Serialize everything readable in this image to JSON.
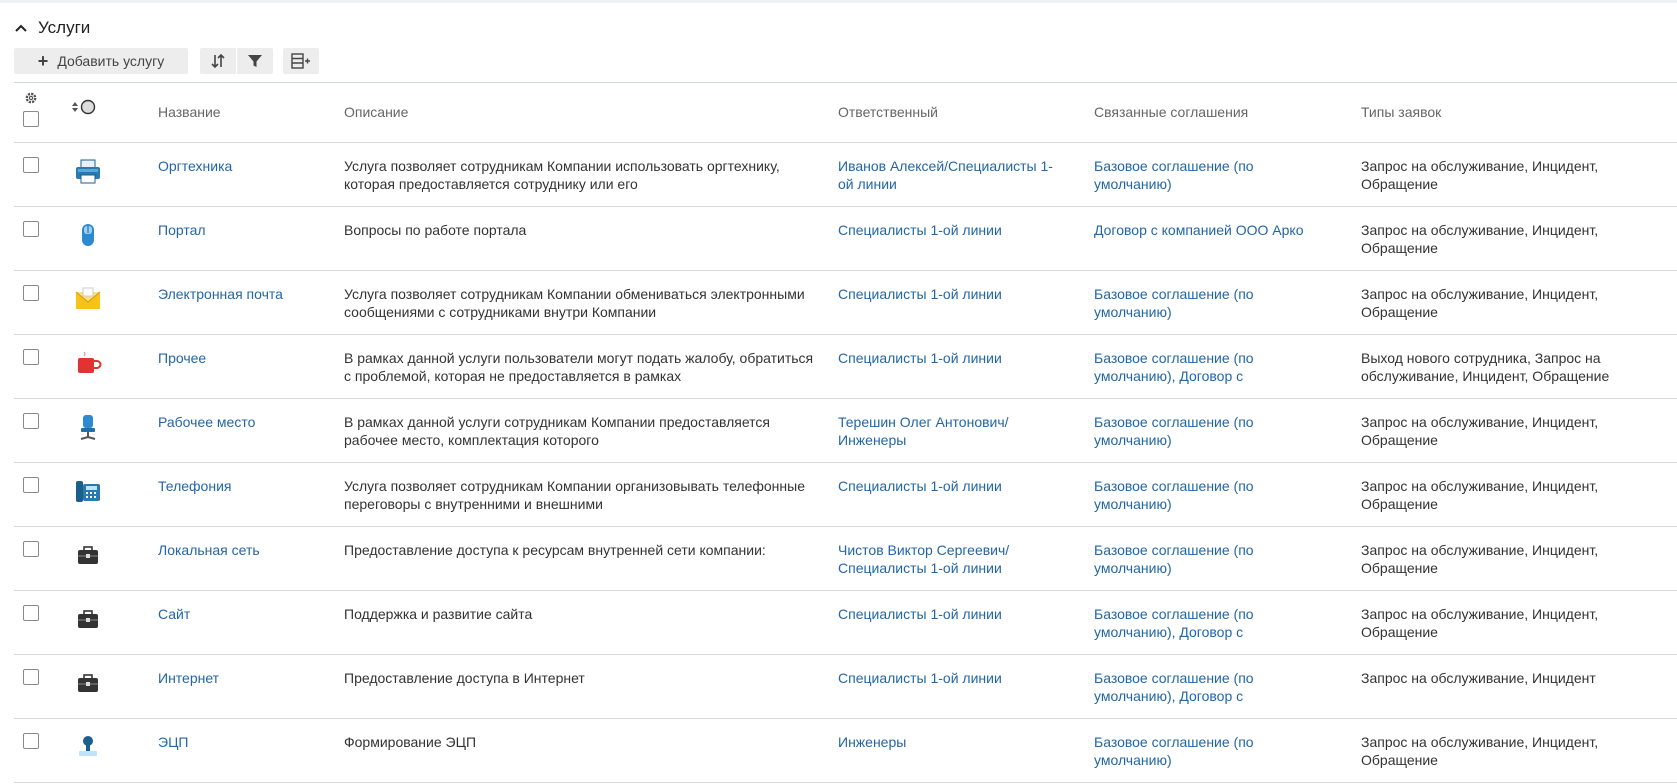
{
  "section": {
    "title": "Услуги"
  },
  "toolbar": {
    "add_label": "Добавить услугу"
  },
  "table": {
    "headers": {
      "name": "Название",
      "description": "Описание",
      "responsible": "Ответственный",
      "agreements": "Связанные соглашения",
      "types": "Типы заявок"
    },
    "rows": [
      {
        "icon": "printer-icon",
        "name": "Оргтехника",
        "description": "Услуга позволяет сотрудникам Компании использовать оргтехнику, которая предоставляется сотруднику или его",
        "responsible_1": "Иванов Алексей",
        "responsible_sep": "/",
        "responsible_2": "Специалисты 1-ой линии",
        "agreements": "Базовое соглашение (по умолчанию)",
        "types": "Запрос на обслуживание, Инцидент, Обращение"
      },
      {
        "icon": "mouse-icon",
        "name": "Портал",
        "description": "Вопросы по работе портала",
        "responsible_1": "Специалисты 1-ой линии",
        "responsible_sep": "",
        "responsible_2": "",
        "agreements": "Договор с компанией ООО Арко",
        "types": "Запрос на обслуживание, Инцидент, Обращение"
      },
      {
        "icon": "envelope-icon",
        "name": "Электронная почта",
        "description": "Услуга позволяет сотрудникам Компании обмениваться электронными сообщениями с сотрудниками внутри Компании",
        "responsible_1": "Специалисты 1-ой линии",
        "responsible_sep": "",
        "responsible_2": "",
        "agreements": "Базовое соглашение (по умолчанию)",
        "types": "Запрос на обслуживание, Инцидент, Обращение"
      },
      {
        "icon": "cup-icon",
        "name": "Прочее",
        "description": "В рамках данной услуги пользователи могут подать жалобу, обратиться с проблемой, которая не предоставляется в рамках",
        "responsible_1": "Специалисты 1-ой линии",
        "responsible_sep": "",
        "responsible_2": "",
        "agreements": "Базовое соглашение (по умолчанию), Договор с",
        "types": "Выход нового сотрудника, Запрос на обслуживание, Инцидент, Обращение"
      },
      {
        "icon": "office-chair-icon",
        "name": "Рабочее место",
        "description": "В рамках данной услуги сотрудникам Компании предоставляется рабочее место, комплектация которого",
        "responsible_1": "Терешин Олег Антонович",
        "responsible_sep": "/",
        "responsible_2": "Инженеры",
        "agreements": "Базовое соглашение (по умолчанию)",
        "types": "Запрос на обслуживание, Инцидент, Обращение"
      },
      {
        "icon": "phone-icon",
        "name": "Телефония",
        "description": "Услуга позволяет сотрудникам Компании организовывать телефонные переговоры с внутренними и внешними",
        "responsible_1": "Специалисты 1-ой линии",
        "responsible_sep": "",
        "responsible_2": "",
        "agreements": "Базовое соглашение (по умолчанию)",
        "types": "Запрос на обслуживание, Инцидент, Обращение"
      },
      {
        "icon": "briefcase-icon",
        "name": "Локальная сеть",
        "description": "Предоставление доступа к ресурсам внутренней сети компании:",
        "responsible_1": "Чистов Виктор Сергеевич",
        "responsible_sep": "/",
        "responsible_2": "Специалисты 1-ой линии",
        "agreements": "Базовое соглашение (по умолчанию)",
        "types": "Запрос на обслуживание, Инцидент, Обращение"
      },
      {
        "icon": "briefcase-icon",
        "name": "Сайт",
        "description": "Поддержка и развитие сайта",
        "responsible_1": "Специалисты 1-ой линии",
        "responsible_sep": "",
        "responsible_2": "",
        "agreements": "Базовое соглашение (по умолчанию), Договор с",
        "types": "Запрос на обслуживание, Инцидент, Обращение"
      },
      {
        "icon": "briefcase-icon",
        "name": "Интернет",
        "description": "Предоставление доступа в Интернет",
        "responsible_1": "Специалисты 1-ой линии",
        "responsible_sep": "",
        "responsible_2": "",
        "agreements": "Базовое соглашение (по умолчанию), Договор с",
        "types": "Запрос на обслуживание, Инцидент"
      },
      {
        "icon": "stamp-icon",
        "name": "ЭЦП",
        "description": "Формирование ЭЦП",
        "responsible_1": "Инженеры",
        "responsible_sep": "",
        "responsible_2": "",
        "agreements": "Базовое соглашение (по умолчанию)",
        "types": "Запрос на обслуживание, Инцидент, Обращение"
      }
    ]
  },
  "colors": {
    "link": "#2266a8",
    "text": "#333333",
    "header_text": "#666666",
    "toolbar_bg": "#ededed",
    "row_border": "#d9d9d9"
  }
}
